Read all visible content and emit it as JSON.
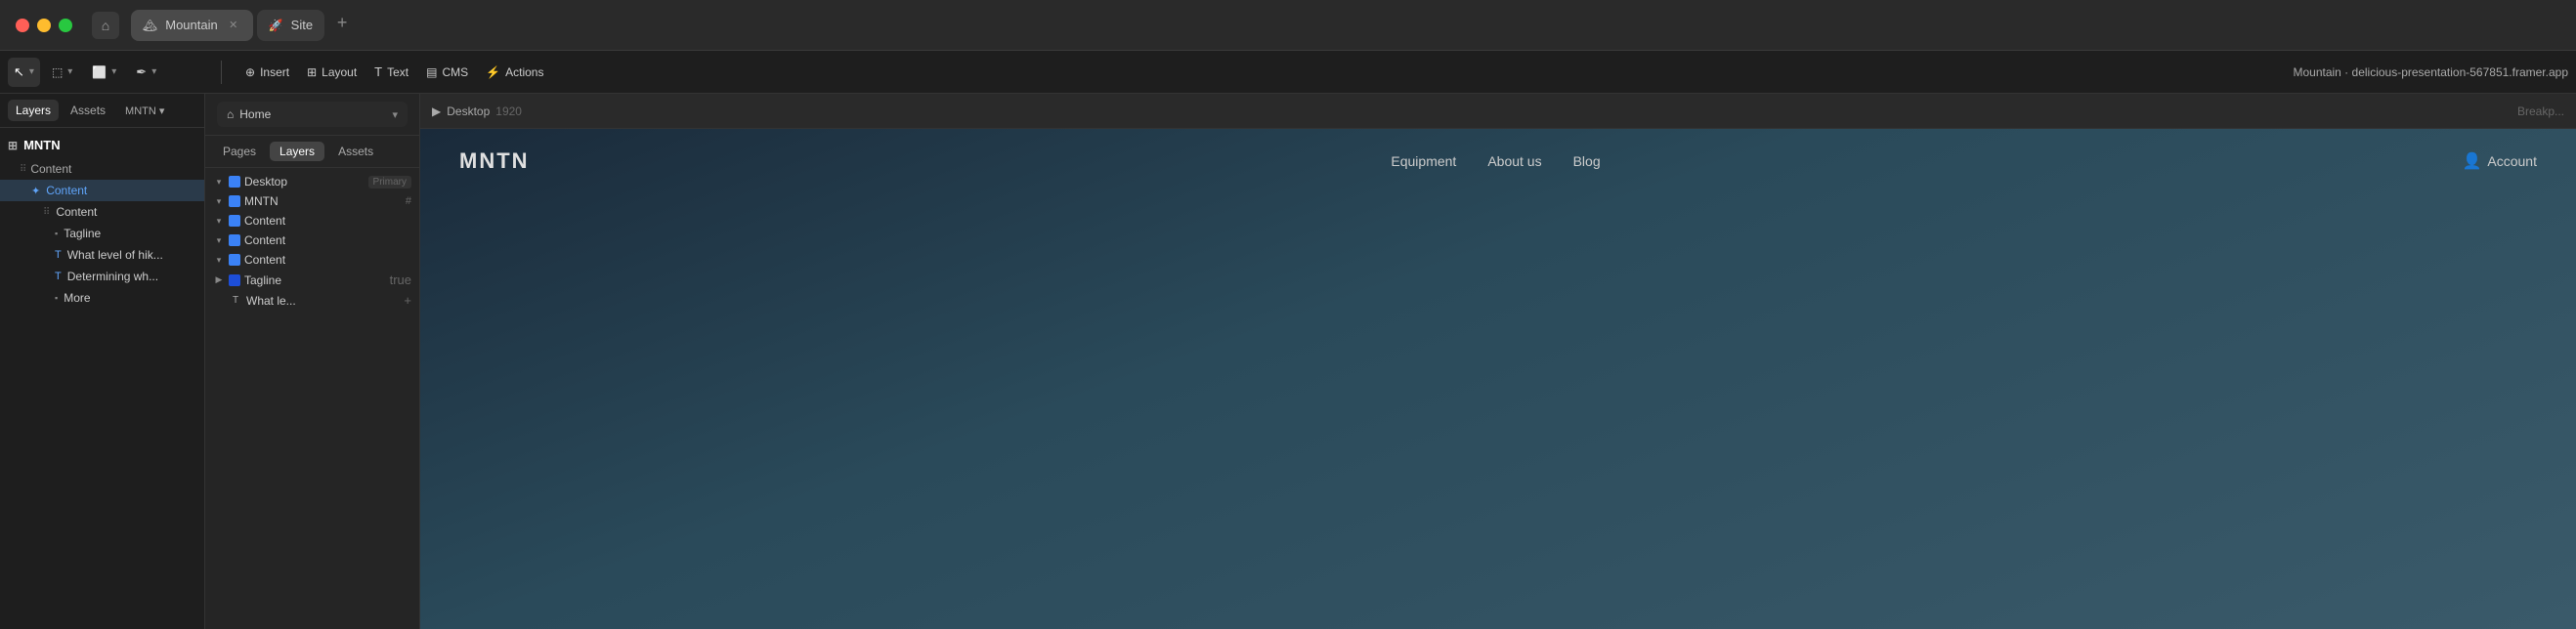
{
  "titlebar": {
    "traffic_lights": [
      "red",
      "yellow",
      "green"
    ],
    "home_icon": "⌂",
    "tabs": [
      {
        "id": "mountain",
        "label": "Mountain",
        "icon": "🏔",
        "active": true,
        "closable": true
      },
      {
        "id": "site",
        "label": "Site",
        "icon": "🚀",
        "active": false,
        "closable": false
      }
    ],
    "add_tab_icon": "+"
  },
  "toolbar": {
    "left_tools": [
      {
        "id": "back",
        "label": "←",
        "icon": "←"
      },
      {
        "id": "insert",
        "label": "Insert",
        "icon": "⊕"
      },
      {
        "id": "layout",
        "label": "Layout",
        "icon": "⊞"
      },
      {
        "id": "text",
        "label": "Text",
        "icon": "T"
      },
      {
        "id": "cms",
        "label": "CMS",
        "icon": "⊟"
      },
      {
        "id": "actions",
        "label": "Actions",
        "icon": "⚡"
      }
    ],
    "site_info": "Mountain · delicious-presentation-567851.framer.app"
  },
  "left_sidebar": {
    "tabs": [
      {
        "id": "layers",
        "label": "Layers",
        "active": true
      },
      {
        "id": "assets",
        "label": "Assets",
        "active": false
      },
      {
        "id": "mntn",
        "label": "MNTN ▾",
        "active": false
      }
    ],
    "items": [
      {
        "id": "mntn-root",
        "label": "MNTN",
        "indent": 0,
        "type": "root"
      },
      {
        "id": "content-group",
        "label": "Content",
        "indent": 1,
        "type": "group"
      },
      {
        "id": "content-item",
        "label": "Content",
        "indent": 2,
        "type": "frame",
        "selected": true
      },
      {
        "id": "content-sub",
        "label": "Content",
        "indent": 3,
        "type": "frame"
      },
      {
        "id": "tagline",
        "label": "Tagline",
        "indent": 4,
        "type": "frame"
      },
      {
        "id": "what-level",
        "label": "What level of hik...",
        "indent": 4,
        "type": "text"
      },
      {
        "id": "determining",
        "label": "Determining wh...",
        "indent": 4,
        "type": "text"
      },
      {
        "id": "more",
        "label": "More",
        "indent": 4,
        "type": "frame"
      }
    ]
  },
  "layers_panel": {
    "page_selector": {
      "label": "Home",
      "icon": "⌂"
    },
    "tabs": [
      {
        "id": "pages",
        "label": "Pages",
        "active": false
      },
      {
        "id": "layers",
        "label": "Layers",
        "active": true
      },
      {
        "id": "assets",
        "label": "Assets",
        "active": false
      }
    ],
    "tree": [
      {
        "id": "desktop",
        "label": "Desktop",
        "badge": "Primary",
        "indent": 0,
        "expanded": true,
        "type": "frame"
      },
      {
        "id": "mntn",
        "label": "MNTN",
        "indent": 1,
        "expanded": true,
        "type": "frame",
        "hash": "#"
      },
      {
        "id": "content-1",
        "label": "Content",
        "indent": 2,
        "expanded": true,
        "type": "frame"
      },
      {
        "id": "content-2",
        "label": "Content",
        "indent": 3,
        "expanded": true,
        "type": "frame"
      },
      {
        "id": "content-3",
        "label": "Content",
        "indent": 4,
        "expanded": true,
        "type": "frame"
      },
      {
        "id": "tagline-layer",
        "label": "Tagline",
        "indent": 5,
        "expanded": false,
        "type": "frame",
        "plus": true
      },
      {
        "id": "what-le",
        "label": "What le...",
        "indent": 5,
        "expanded": false,
        "type": "text",
        "plus": true
      }
    ]
  },
  "canvas": {
    "desktop_label": "Desktop",
    "desktop_size": "1920",
    "play_icon": "▶",
    "breakpoint_label": "Breakp..."
  },
  "preview": {
    "logo": "MNTN",
    "nav_links": [
      "Equipment",
      "About us",
      "Blog"
    ],
    "account_label": "Account",
    "account_icon": "👤"
  },
  "icons": {
    "chevron_right": "▶",
    "chevron_down": "▾",
    "home": "⌂",
    "grid": "⊞",
    "hash": "#",
    "plus": "+",
    "insert": "⊕",
    "text_T": "T",
    "cms": "▤",
    "actions": "⚡",
    "play": "▶",
    "cursor": "↖",
    "frame": "⬚",
    "component": "✦",
    "drag": "⠿"
  }
}
